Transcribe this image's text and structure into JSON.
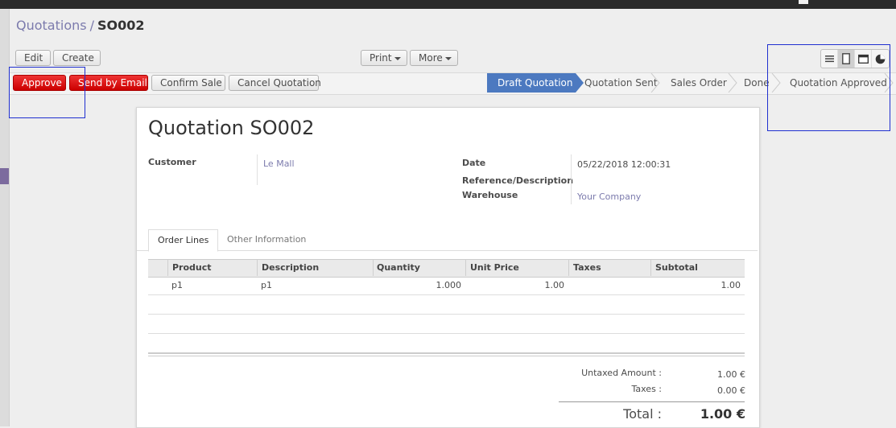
{
  "breadcrumb": {
    "parent": "Quotations",
    "separator": "/",
    "current": "SO002"
  },
  "toolbar": {
    "edit": "Edit",
    "create": "Create",
    "print": "Print",
    "more": "More"
  },
  "views": [
    "list-icon",
    "form-icon",
    "calendar-icon",
    "graph-icon"
  ],
  "actions": {
    "approve": "Approve",
    "send_email": "Send by Email",
    "confirm": "Confirm Sale",
    "cancel": "Cancel Quotation"
  },
  "stages": [
    "Draft Quotation",
    "Quotation Sent",
    "Sales Order",
    "Done",
    "Quotation Approved"
  ],
  "record": {
    "title_prefix": "Quotation",
    "title_name": "SO002",
    "customer_label": "Customer",
    "customer_value": "Le Mall",
    "date_label": "Date",
    "date_value": "05/22/2018 12:00:31",
    "ref_label": "Reference/Description",
    "warehouse_label": "Warehouse",
    "warehouse_value": "Your Company"
  },
  "tabs": {
    "order_lines": "Order Lines",
    "other_info": "Other Information"
  },
  "lines": {
    "headers": {
      "product": "Product",
      "description": "Description",
      "quantity": "Quantity",
      "unit_price": "Unit Price",
      "taxes": "Taxes",
      "subtotal": "Subtotal"
    },
    "rows": [
      {
        "product": "p1",
        "description": "p1",
        "quantity": "1.000",
        "unit_price": "1.00",
        "taxes": "",
        "subtotal": "1.00"
      }
    ]
  },
  "totals": {
    "untaxed_label": "Untaxed Amount :",
    "untaxed_value": "1.00 €",
    "taxes_label": "Taxes :",
    "taxes_value": "0.00 €",
    "total_label": "Total :",
    "total_value": "1.00 €"
  },
  "colors": {
    "approve_red": "#cc0000",
    "active_stage": "#4c79c0",
    "link": "#7c7bad",
    "highlight_box": "#1f2fd0"
  }
}
